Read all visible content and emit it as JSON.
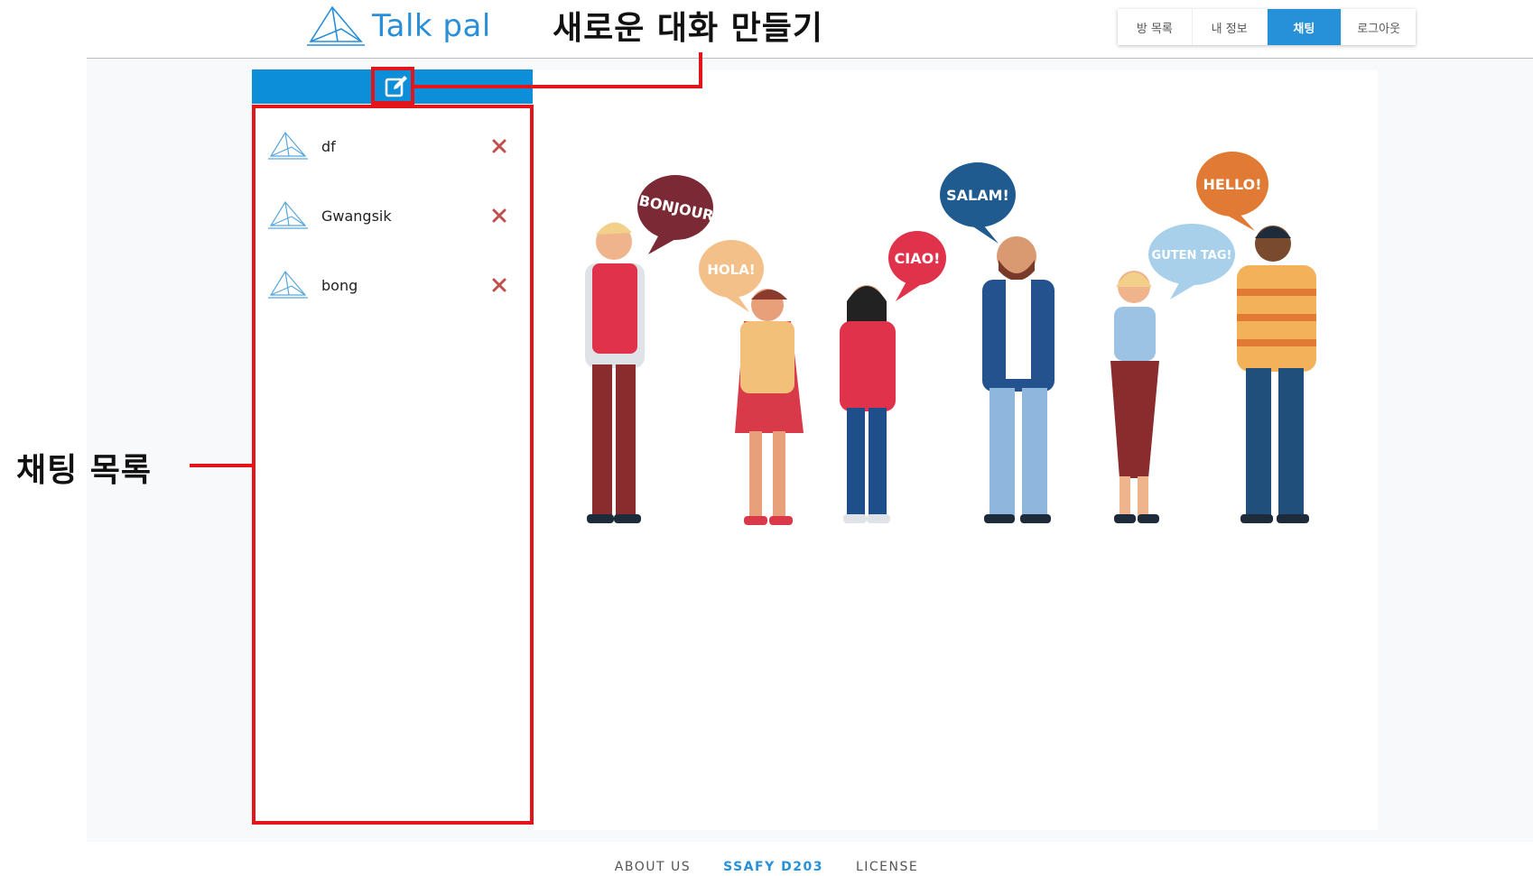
{
  "header": {
    "logo_text": "Talk pal",
    "nav": [
      {
        "label": "방 목록",
        "active": false
      },
      {
        "label": "내 정보",
        "active": false
      },
      {
        "label": "채팅",
        "active": true
      },
      {
        "label": "로그아웃",
        "active": false
      }
    ]
  },
  "annotations": {
    "new_chat": "새로운 대화 만들기",
    "chat_list": "채팅 목록"
  },
  "sidebar": {
    "compose_icon": "edit-icon",
    "rooms": [
      {
        "name": "df",
        "icon": "paper-plane-icon"
      },
      {
        "name": "Gwangsik",
        "icon": "paper-plane-icon"
      },
      {
        "name": "bong",
        "icon": "paper-plane-icon"
      }
    ]
  },
  "illustration": {
    "bubbles": [
      "BONJOUR",
      "HOLA!",
      "CIAO!",
      "SALAM!",
      "GUTEN TAG!",
      "HELLO!"
    ]
  },
  "footer": {
    "about": "ABOUT US",
    "brand": "SSAFY D203",
    "license": "LICENSE"
  },
  "colors": {
    "primary": "#2690d8",
    "sidebar_header": "#0d8ed9",
    "annotation_red": "#e4141b",
    "delete_x": "#c0504d"
  }
}
